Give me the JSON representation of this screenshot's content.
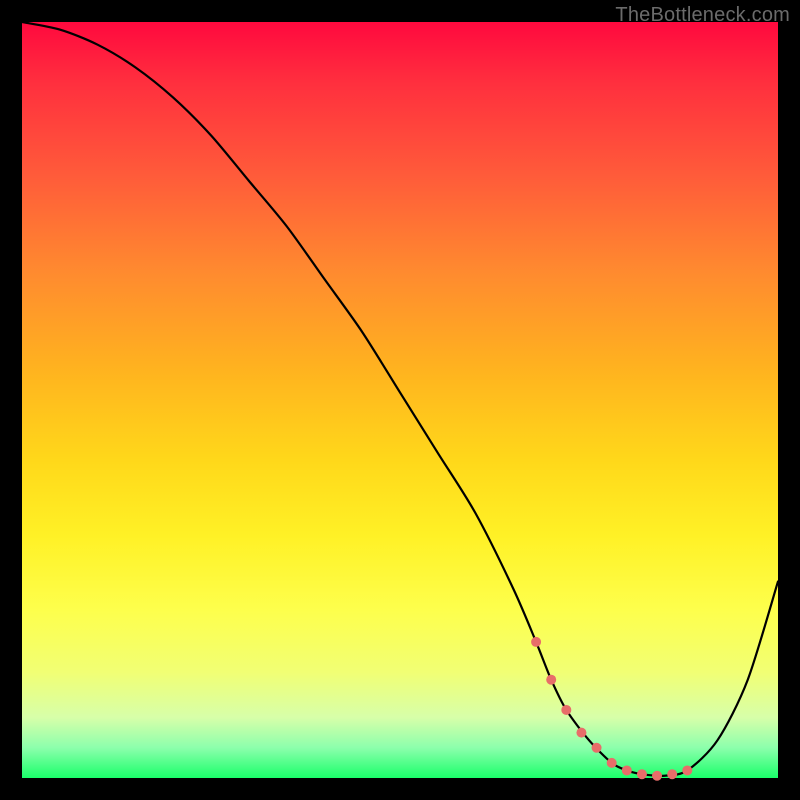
{
  "watermark": "TheBottleneck.com",
  "chart_data": {
    "type": "line",
    "title": "",
    "xlabel": "",
    "ylabel": "",
    "xlim": [
      0,
      100
    ],
    "ylim": [
      0,
      100
    ],
    "series": [
      {
        "name": "bottleneck-curve",
        "x": [
          0,
          5,
          10,
          15,
          20,
          25,
          30,
          35,
          40,
          45,
          50,
          55,
          60,
          65,
          68,
          70,
          72,
          75,
          78,
          80,
          82,
          85,
          88,
          92,
          96,
          100
        ],
        "values": [
          100,
          99,
          97,
          94,
          90,
          85,
          79,
          73,
          66,
          59,
          51,
          43,
          35,
          25,
          18,
          13,
          9,
          5,
          2,
          1,
          0.5,
          0.3,
          1,
          5,
          13,
          26
        ]
      }
    ],
    "markers": {
      "name": "optimum-dots",
      "color": "#e86d69",
      "points": [
        {
          "x": 68,
          "y": 18
        },
        {
          "x": 70,
          "y": 13
        },
        {
          "x": 72,
          "y": 9
        },
        {
          "x": 74,
          "y": 6
        },
        {
          "x": 76,
          "y": 4
        },
        {
          "x": 78,
          "y": 2
        },
        {
          "x": 80,
          "y": 1
        },
        {
          "x": 82,
          "y": 0.5
        },
        {
          "x": 84,
          "y": 0.3
        },
        {
          "x": 86,
          "y": 0.5
        },
        {
          "x": 88,
          "y": 1
        }
      ]
    }
  }
}
